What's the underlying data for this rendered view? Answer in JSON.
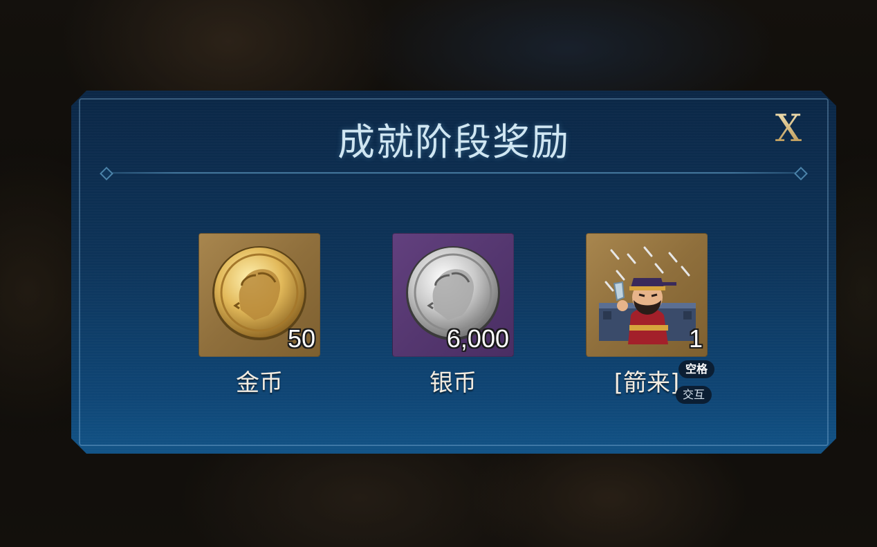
{
  "dialog": {
    "title": "成就阶段奖励",
    "close_label": "X"
  },
  "rewards": [
    {
      "name": "金币",
      "quantity": "50",
      "icon": "gold-coin-icon",
      "tile_color": "#9a7a45"
    },
    {
      "name": "银币",
      "quantity": "6,000",
      "icon": "silver-coin-icon",
      "tile_color": "#5a3b75"
    },
    {
      "name": "[箭来]",
      "quantity": "1",
      "icon": "arrow-rain-character-icon",
      "tile_color": "#9a7a45"
    }
  ],
  "hints": {
    "key": "空格",
    "action": "交互"
  },
  "colors": {
    "panel": "#0d3358",
    "title": "#cfe6f2",
    "close": "#d8c28b"
  }
}
